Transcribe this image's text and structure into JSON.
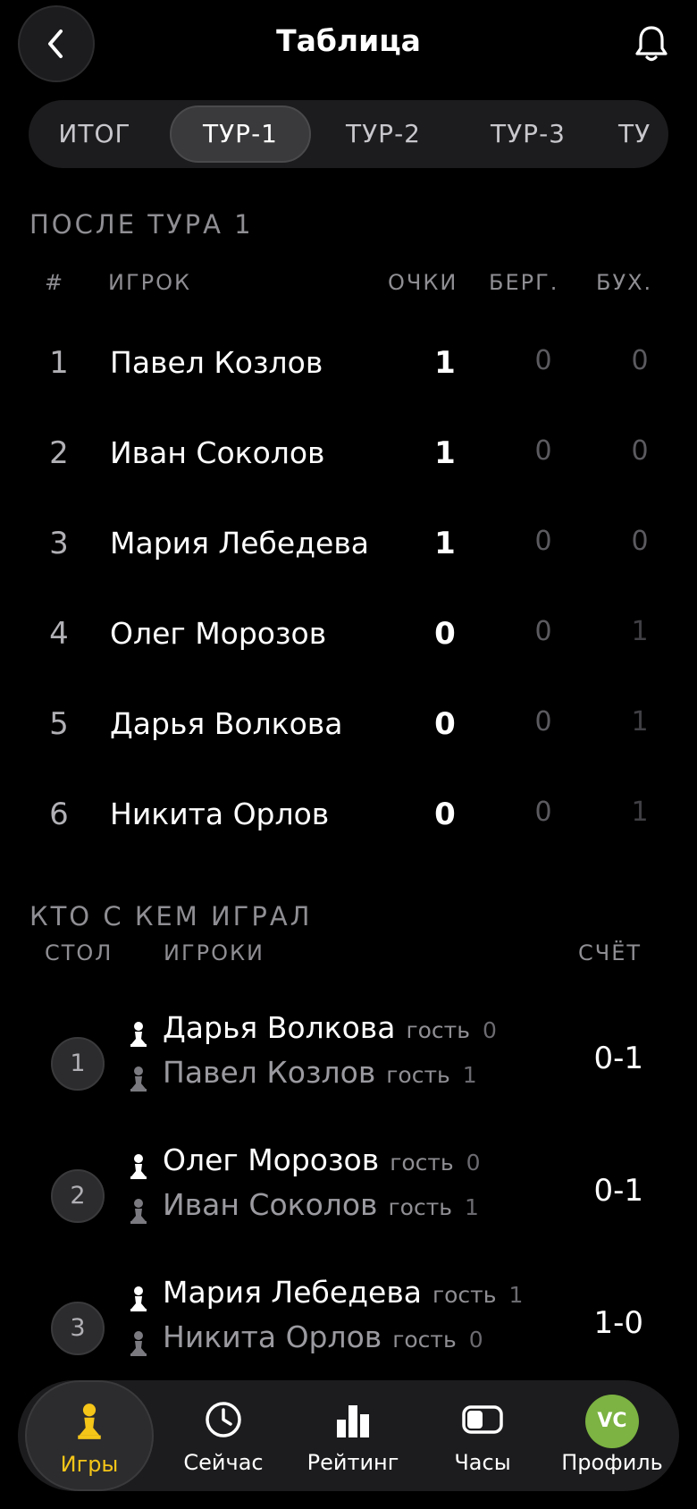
{
  "header": {
    "title": "Таблица"
  },
  "tabs": [
    {
      "label": "ИТОГ"
    },
    {
      "label": "ТУР-1"
    },
    {
      "label": "ТУР-2"
    },
    {
      "label": "ТУР-3"
    },
    {
      "label": "ТУ"
    }
  ],
  "standings": {
    "heading": "ПОСЛЕ ТУРА 1",
    "columns": {
      "rank": "#",
      "player": "ИГРОК",
      "points": "ОЧКИ",
      "berger": "БЕРГ.",
      "buchholz": "БУХ."
    },
    "rows": [
      {
        "rank": "1",
        "name": "Павел Козлов",
        "points": "1",
        "berger": "0",
        "buchholz": "0"
      },
      {
        "rank": "2",
        "name": "Иван Соколов",
        "points": "1",
        "berger": "0",
        "buchholz": "0"
      },
      {
        "rank": "3",
        "name": "Мария Лебедева",
        "points": "1",
        "berger": "0",
        "buchholz": "0"
      },
      {
        "rank": "4",
        "name": "Олег Морозов",
        "points": "0",
        "berger": "0",
        "buchholz": "1"
      },
      {
        "rank": "5",
        "name": "Дарья Волкова",
        "points": "0",
        "berger": "0",
        "buchholz": "1"
      },
      {
        "rank": "6",
        "name": "Никита Орлов",
        "points": "0",
        "berger": "0",
        "buchholz": "1"
      }
    ]
  },
  "pairings": {
    "heading": "КТО С КЕМ ИГРАЛ",
    "columns": {
      "table": "СТОЛ",
      "players": "ИГРОКИ",
      "score": "СЧЁТ"
    },
    "rows": [
      {
        "table": "1",
        "white": {
          "name": "Дарья Волкова",
          "tag": "гость",
          "score": "0"
        },
        "black": {
          "name": "Павел Козлов",
          "tag": "гость",
          "score": "1"
        },
        "result": "0-1"
      },
      {
        "table": "2",
        "white": {
          "name": "Олег Морозов",
          "tag": "гость",
          "score": "0"
        },
        "black": {
          "name": "Иван Соколов",
          "tag": "гость",
          "score": "1"
        },
        "result": "0-1"
      },
      {
        "table": "3",
        "white": {
          "name": "Мария Лебедева",
          "tag": "гость",
          "score": "1"
        },
        "black": {
          "name": "Никита Орлов",
          "tag": "гость",
          "score": "0"
        },
        "result": "1-0"
      }
    ]
  },
  "nav": {
    "items": [
      {
        "label": "Игры",
        "icon": "pawn-icon"
      },
      {
        "label": "Сейчас",
        "icon": "clock-icon"
      },
      {
        "label": "Рейтинг",
        "icon": "bar-chart-icon"
      },
      {
        "label": "Часы",
        "icon": "chess-clock-icon"
      },
      {
        "label": "Профиль",
        "icon": "avatar"
      }
    ],
    "avatar_initials": "VC",
    "active_color": "#f5c518",
    "avatar_color": "#7cb342"
  }
}
